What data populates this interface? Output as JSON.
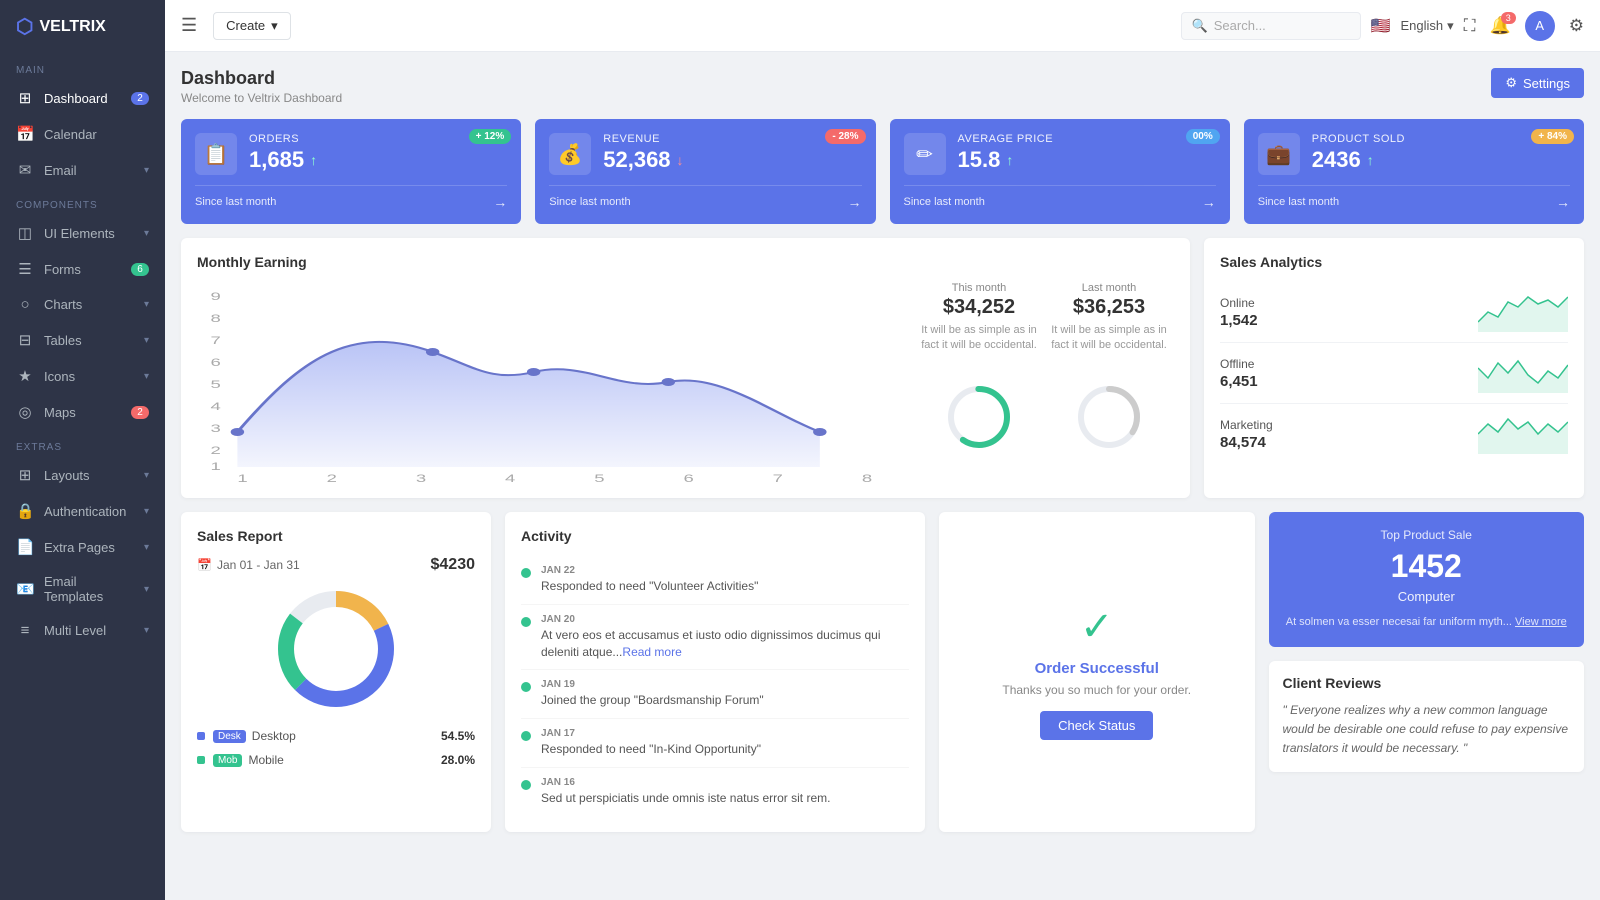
{
  "sidebar": {
    "logo": "VELTRIX",
    "sections": [
      {
        "label": "MAIN",
        "items": [
          {
            "id": "dashboard",
            "icon": "⊞",
            "label": "Dashboard",
            "badge": "2",
            "badgeColor": "blue",
            "arrow": false,
            "active": true
          },
          {
            "id": "calendar",
            "icon": "📅",
            "label": "Calendar",
            "badge": "",
            "arrow": false
          },
          {
            "id": "email",
            "icon": "✉",
            "label": "Email",
            "badge": "",
            "arrow": true
          }
        ]
      },
      {
        "label": "COMPONENTS",
        "items": [
          {
            "id": "ui-elements",
            "icon": "◫",
            "label": "UI Elements",
            "badge": "",
            "arrow": true
          },
          {
            "id": "forms",
            "icon": "☰",
            "label": "Forms",
            "badge": "6",
            "badgeColor": "green",
            "arrow": false
          },
          {
            "id": "charts",
            "icon": "○",
            "label": "Charts",
            "badge": "",
            "arrow": true
          },
          {
            "id": "tables",
            "icon": "⊟",
            "label": "Tables",
            "badge": "",
            "arrow": true
          },
          {
            "id": "icons",
            "icon": "★",
            "label": "Icons",
            "badge": "",
            "arrow": true
          },
          {
            "id": "maps",
            "icon": "◎",
            "label": "Maps",
            "badge": "2",
            "badgeColor": "red",
            "arrow": false
          }
        ]
      },
      {
        "label": "EXTRAS",
        "items": [
          {
            "id": "layouts",
            "icon": "⊞",
            "label": "Layouts",
            "badge": "",
            "arrow": true
          },
          {
            "id": "authentication",
            "icon": "🔒",
            "label": "Authentication",
            "badge": "",
            "arrow": true
          },
          {
            "id": "extra-pages",
            "icon": "📄",
            "label": "Extra Pages",
            "badge": "",
            "arrow": true
          },
          {
            "id": "email-templates",
            "icon": "📧",
            "label": "Email Templates",
            "badge": "",
            "arrow": true
          },
          {
            "id": "multi-level",
            "icon": "≡",
            "label": "Multi Level",
            "badge": "",
            "arrow": true
          }
        ]
      }
    ]
  },
  "topbar": {
    "hamburger_label": "☰",
    "create_btn": "Create",
    "search_placeholder": "Search...",
    "search_icon": "🔍",
    "language_flag": "🇺🇸",
    "language": "English",
    "notif_count": "3",
    "expand_icon": "⛶",
    "gear_icon": "⚙"
  },
  "page": {
    "title": "Dashboard",
    "subtitle": "Welcome to Veltrix Dashboard",
    "settings_btn": "Settings"
  },
  "stat_cards": [
    {
      "label": "ORDERS",
      "value": "1,685",
      "trend_icon": "↑",
      "badge": "+ 12%",
      "badge_color": "green",
      "icon": "📋",
      "footer": "Since last month"
    },
    {
      "label": "REVENUE",
      "value": "52,368",
      "trend_icon": "↓",
      "badge": "- 28%",
      "badge_color": "red",
      "icon": "💰",
      "footer": "Since last month"
    },
    {
      "label": "AVERAGE PRICE",
      "value": "15.8",
      "trend_icon": "↑",
      "badge": "00%",
      "badge_color": "blue",
      "icon": "✏",
      "footer": "Since last month"
    },
    {
      "label": "PRODUCT SOLD",
      "value": "2436",
      "trend_icon": "↑",
      "badge": "+ 84%",
      "badge_color": "yellow",
      "icon": "💼",
      "footer": "Since last month"
    }
  ],
  "monthly_earning": {
    "title": "Monthly Earning",
    "this_month_label": "This month",
    "this_month_value": "$34,252",
    "this_month_desc": "It will be as simple as in fact it will be occidental.",
    "last_month_label": "Last month",
    "last_month_value": "$36,253",
    "last_month_desc": "It will be as simple as in fact it will be occidental."
  },
  "sales_analytics": {
    "title": "Sales Analytics",
    "rows": [
      {
        "type": "Online",
        "value": "1,542"
      },
      {
        "type": "Offline",
        "value": "6,451"
      },
      {
        "type": "Marketing",
        "value": "84,574"
      }
    ]
  },
  "sales_report": {
    "title": "Sales Report",
    "date_range": "Jan 01 - Jan 31",
    "total": "$4230",
    "segments": [
      {
        "label": "Desktop",
        "tag": "Desk",
        "tag_color": "#5b73e8",
        "percent": "54.5%",
        "color": "#5b73e8"
      },
      {
        "label": "Mobile",
        "tag": "Mob",
        "tag_color": "#34c38f",
        "percent": "28.0%",
        "color": "#34c38f"
      }
    ]
  },
  "activity": {
    "title": "Activity",
    "items": [
      {
        "date": "JAN 22",
        "text": "Responded to need \"Volunteer Activities\""
      },
      {
        "date": "JAN 20",
        "text": "At vero eos et accusamus et iusto odio dignissimos ducimus qui deleniti atque...",
        "link": "Read more"
      },
      {
        "date": "JAN 19",
        "text": "Joined the group \"Boardsmanship Forum\""
      },
      {
        "date": "JAN 17",
        "text": "Responded to need \"In-Kind Opportunity\""
      },
      {
        "date": "JAN 16",
        "text": "Sed ut perspiciatis unde omnis iste natus error sit rem."
      }
    ]
  },
  "order_successful": {
    "title": "Order Successful",
    "desc": "Thanks you so much for your order.",
    "btn": "Check Status"
  },
  "top_product": {
    "label": "Top Product Sale",
    "value": "1452",
    "product": "Computer",
    "desc": "At solmen va esser necesai far uniform myth...",
    "link": "View more"
  },
  "client_reviews": {
    "title": "Client Reviews",
    "text": "\" Everyone realizes why a new common language would be desirable one could refuse to pay expensive translators it would be necessary. \""
  }
}
